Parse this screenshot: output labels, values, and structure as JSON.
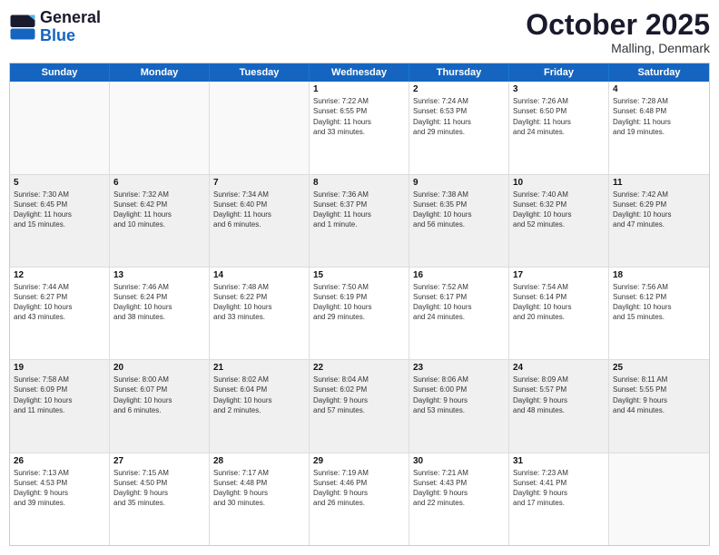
{
  "header": {
    "logo_general": "General",
    "logo_blue": "Blue",
    "month_title": "October 2025",
    "location": "Malling, Denmark"
  },
  "weekdays": [
    "Sunday",
    "Monday",
    "Tuesday",
    "Wednesday",
    "Thursday",
    "Friday",
    "Saturday"
  ],
  "rows": [
    [
      {
        "day": "",
        "info": ""
      },
      {
        "day": "",
        "info": ""
      },
      {
        "day": "",
        "info": ""
      },
      {
        "day": "1",
        "info": "Sunrise: 7:22 AM\nSunset: 6:55 PM\nDaylight: 11 hours\nand 33 minutes."
      },
      {
        "day": "2",
        "info": "Sunrise: 7:24 AM\nSunset: 6:53 PM\nDaylight: 11 hours\nand 29 minutes."
      },
      {
        "day": "3",
        "info": "Sunrise: 7:26 AM\nSunset: 6:50 PM\nDaylight: 11 hours\nand 24 minutes."
      },
      {
        "day": "4",
        "info": "Sunrise: 7:28 AM\nSunset: 6:48 PM\nDaylight: 11 hours\nand 19 minutes."
      }
    ],
    [
      {
        "day": "5",
        "info": "Sunrise: 7:30 AM\nSunset: 6:45 PM\nDaylight: 11 hours\nand 15 minutes."
      },
      {
        "day": "6",
        "info": "Sunrise: 7:32 AM\nSunset: 6:42 PM\nDaylight: 11 hours\nand 10 minutes."
      },
      {
        "day": "7",
        "info": "Sunrise: 7:34 AM\nSunset: 6:40 PM\nDaylight: 11 hours\nand 6 minutes."
      },
      {
        "day": "8",
        "info": "Sunrise: 7:36 AM\nSunset: 6:37 PM\nDaylight: 11 hours\nand 1 minute."
      },
      {
        "day": "9",
        "info": "Sunrise: 7:38 AM\nSunset: 6:35 PM\nDaylight: 10 hours\nand 56 minutes."
      },
      {
        "day": "10",
        "info": "Sunrise: 7:40 AM\nSunset: 6:32 PM\nDaylight: 10 hours\nand 52 minutes."
      },
      {
        "day": "11",
        "info": "Sunrise: 7:42 AM\nSunset: 6:29 PM\nDaylight: 10 hours\nand 47 minutes."
      }
    ],
    [
      {
        "day": "12",
        "info": "Sunrise: 7:44 AM\nSunset: 6:27 PM\nDaylight: 10 hours\nand 43 minutes."
      },
      {
        "day": "13",
        "info": "Sunrise: 7:46 AM\nSunset: 6:24 PM\nDaylight: 10 hours\nand 38 minutes."
      },
      {
        "day": "14",
        "info": "Sunrise: 7:48 AM\nSunset: 6:22 PM\nDaylight: 10 hours\nand 33 minutes."
      },
      {
        "day": "15",
        "info": "Sunrise: 7:50 AM\nSunset: 6:19 PM\nDaylight: 10 hours\nand 29 minutes."
      },
      {
        "day": "16",
        "info": "Sunrise: 7:52 AM\nSunset: 6:17 PM\nDaylight: 10 hours\nand 24 minutes."
      },
      {
        "day": "17",
        "info": "Sunrise: 7:54 AM\nSunset: 6:14 PM\nDaylight: 10 hours\nand 20 minutes."
      },
      {
        "day": "18",
        "info": "Sunrise: 7:56 AM\nSunset: 6:12 PM\nDaylight: 10 hours\nand 15 minutes."
      }
    ],
    [
      {
        "day": "19",
        "info": "Sunrise: 7:58 AM\nSunset: 6:09 PM\nDaylight: 10 hours\nand 11 minutes."
      },
      {
        "day": "20",
        "info": "Sunrise: 8:00 AM\nSunset: 6:07 PM\nDaylight: 10 hours\nand 6 minutes."
      },
      {
        "day": "21",
        "info": "Sunrise: 8:02 AM\nSunset: 6:04 PM\nDaylight: 10 hours\nand 2 minutes."
      },
      {
        "day": "22",
        "info": "Sunrise: 8:04 AM\nSunset: 6:02 PM\nDaylight: 9 hours\nand 57 minutes."
      },
      {
        "day": "23",
        "info": "Sunrise: 8:06 AM\nSunset: 6:00 PM\nDaylight: 9 hours\nand 53 minutes."
      },
      {
        "day": "24",
        "info": "Sunrise: 8:09 AM\nSunset: 5:57 PM\nDaylight: 9 hours\nand 48 minutes."
      },
      {
        "day": "25",
        "info": "Sunrise: 8:11 AM\nSunset: 5:55 PM\nDaylight: 9 hours\nand 44 minutes."
      }
    ],
    [
      {
        "day": "26",
        "info": "Sunrise: 7:13 AM\nSunset: 4:53 PM\nDaylight: 9 hours\nand 39 minutes."
      },
      {
        "day": "27",
        "info": "Sunrise: 7:15 AM\nSunset: 4:50 PM\nDaylight: 9 hours\nand 35 minutes."
      },
      {
        "day": "28",
        "info": "Sunrise: 7:17 AM\nSunset: 4:48 PM\nDaylight: 9 hours\nand 30 minutes."
      },
      {
        "day": "29",
        "info": "Sunrise: 7:19 AM\nSunset: 4:46 PM\nDaylight: 9 hours\nand 26 minutes."
      },
      {
        "day": "30",
        "info": "Sunrise: 7:21 AM\nSunset: 4:43 PM\nDaylight: 9 hours\nand 22 minutes."
      },
      {
        "day": "31",
        "info": "Sunrise: 7:23 AM\nSunset: 4:41 PM\nDaylight: 9 hours\nand 17 minutes."
      },
      {
        "day": "",
        "info": ""
      }
    ]
  ]
}
